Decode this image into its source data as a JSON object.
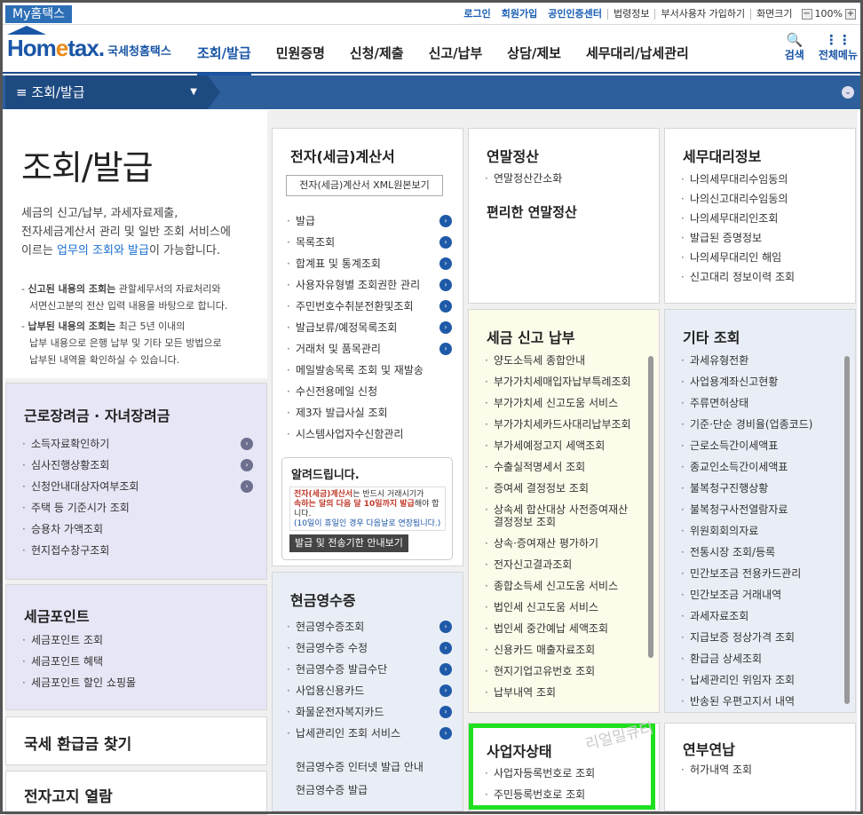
{
  "topbar": {
    "mytax": "My홈택스",
    "login": "로그인",
    "join": "회원가입",
    "cert": "공인인증센터",
    "law": "법령정보",
    "dept_join": "부서사용자 가입하기",
    "screen": "화면크기",
    "zoom": "100%",
    "zoom_minus": "−",
    "zoom_plus": "+"
  },
  "header": {
    "logo_home": "Hom",
    "logo_e": "e",
    "logo_tax": "tax.",
    "logo_kr": "국세청홈택스",
    "nav": [
      "조회/발급",
      "민원증명",
      "신청/제출",
      "신고/납부",
      "상담/제보",
      "세무대리/납세관리"
    ],
    "search_label": "검색",
    "menu_label": "전체메뉴",
    "search_icon": "🔍",
    "menu_icon": "⋮⋮"
  },
  "breadcrumb": {
    "label": "≡  조회/발급",
    "dropdown": "▼",
    "right_btn": "⌄"
  },
  "intro": {
    "title": "조회/발급",
    "desc1": "세금의 신고/납부, 과세자료제출,",
    "desc2": "전자세금계산서 관리 및 일반 조회 서비스에",
    "desc3_pre": "이르는 ",
    "desc3_link": "업무의 조회와 발급",
    "desc3_post": "이 가능합니다.",
    "note1_b": "신고된 내용의 조회는",
    "note1": " 관할세무서의 자료처리와",
    "note1b": "서면신고분의 전산 입력 내용을 바탕으로 합니다.",
    "note2_b": "납부된 내용의 조회는",
    "note2": " 최근 5년 이내의",
    "note2b": "납부 내용으로 은행 납부 및 기타 모든 방법으로",
    "note2c": "납부된 내역을 확인하실 수 있습니다."
  },
  "labor": {
    "title": "근로장려금 · 자녀장려금",
    "items": [
      "소득자료확인하기",
      "심사진행상황조회",
      "신청안내대상자여부조회",
      "주택 등 기준시가 조회",
      "승용차 가액조회",
      "현지접수창구조회"
    ]
  },
  "points": {
    "title": "세금포인트",
    "items": [
      "세금포인트 조회",
      "세금포인트 혜택",
      "세금포인트 할인 쇼핑몰"
    ]
  },
  "refund": {
    "title": "국세 환급금 찾기"
  },
  "ebill": {
    "title": "전자고지 열람"
  },
  "einvoice": {
    "title": "전자(세금)계산서",
    "xml_btn": "전자(세금)계산서 XML원본보기",
    "items": [
      "발급",
      "목록조회",
      "합계표 및 통계조회",
      "사용자유형별 조회권한 관리",
      "주민번호수취분전환및조회",
      "발급보류/예정목록조회",
      "거래처 및 품목관리",
      "메일발송목록 조회 및 재발송",
      "수신전용메일 신청",
      "제3자 발급사실 조회",
      "시스템사업자수신함관리"
    ],
    "notice_title": "알려드립니다.",
    "notice_red": "전자(세금)계산서",
    "notice_text1": "는 반드시 거래시기가",
    "notice_text2": "속하는 달의 다음 달 10일까지 발급",
    "notice_text3": "해야 합니다.",
    "notice_sub": "(10일이 휴일인 경우 다음날로 연장됩니다.)",
    "notice_btn": "발급 및 전송기한 안내보기"
  },
  "cash": {
    "title": "현금영수증",
    "items": [
      "현금영수증조회",
      "현금영수증 수정",
      "현금영수증 발급수단",
      "사업용신용카드",
      "화물운전자복지카드",
      "납세관리인 조회 서비스"
    ],
    "plain": [
      "현금영수증 인터넷 발급 안내",
      "현금영수증 발급"
    ]
  },
  "yearend": {
    "title": "연말정산",
    "item": "연말정산간소화",
    "sub": "편리한 연말정산"
  },
  "taxpay": {
    "title": "세금 신고 납부",
    "items": [
      "양도소득세 종합안내",
      "부가가치세매입자납부특례조회",
      "부가가치세 신고도움 서비스",
      "부가가치세카드사대리납부조회",
      "부가세예정고지 세액조회",
      "수출실적명세서 조회",
      "증여세 결정정보 조회",
      "상속세 합산대상 사전증여재산",
      "결정정보 조회",
      "상속·증여재산 평가하기",
      "전자신고결과조회",
      "종합소득세 신고도움 서비스",
      "법인세 신고도움 서비스",
      "법인세 중간예납 세액조회",
      "신용카드 매출자료조회",
      "현지기업고유번호 조회",
      "납부내역 조회"
    ]
  },
  "bizstatus": {
    "title": "사업자상태",
    "items": [
      "사업자등록번호로 조회",
      "주민등록번호로 조회"
    ]
  },
  "agent": {
    "title": "세무대리정보",
    "items": [
      "나의세무대리수임동의",
      "나의신고대리수임동의",
      "나의세무대리인조회",
      "발급된 증명정보",
      "나의세무대리인 해임",
      "신고대리 정보이력 조회"
    ]
  },
  "etc": {
    "title": "기타 조회",
    "items": [
      "과세유형전환",
      "사업용계좌신고현황",
      "주류면허상태",
      "기준·단순 경비율(업종코드)",
      "근로소득간이세액표",
      "종교인소득간이세액표",
      "불복청구진행상황",
      "불복청구사전열람자료",
      "위원회회의자료",
      "전통시장 조회/등록",
      "민간보조금 전용카드관리",
      "민간보조금 거래내역",
      "과세자료조회",
      "지급보증 정상가격 조회",
      "환급금 상세조회",
      "납세관리인 위임자 조회",
      "반송된 우편고지서 내역"
    ]
  },
  "pension": {
    "title": "연부연납",
    "item": "허가내역 조회"
  },
  "watermark": "리얼밀큐티",
  "colors": {
    "brand": "#1a56a6",
    "nav_bar": "#2d5f9c",
    "highlight": "#1ee01e"
  }
}
